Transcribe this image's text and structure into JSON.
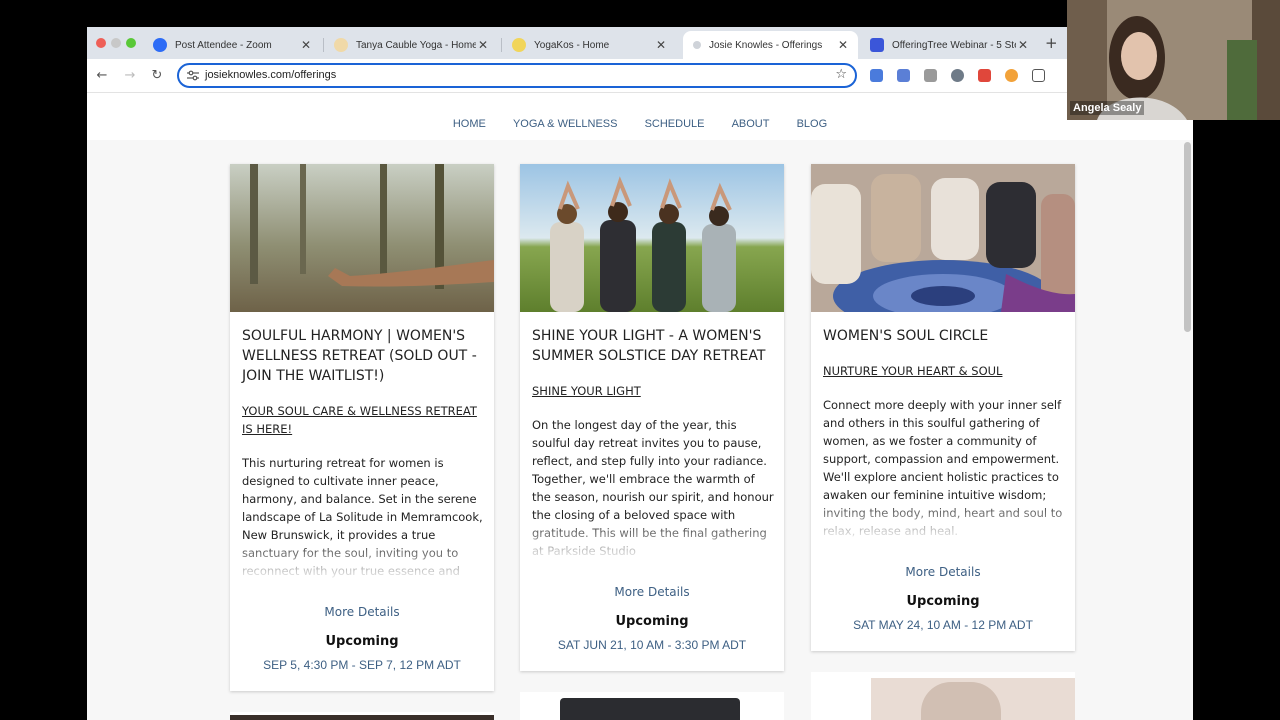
{
  "tabs": [
    {
      "title": "Post Attendee - Zoom",
      "favicon_color": "#2d6cf6",
      "active": false
    },
    {
      "title": "Tanya Cauble Yoga - Home",
      "favicon_color": "#f0d9a8",
      "active": false
    },
    {
      "title": "YogaKos - Home",
      "favicon_color": "#f1d55a",
      "active": false
    },
    {
      "title": "Josie Knowles - Offerings",
      "favicon_color": "#cfd3d9",
      "active": true
    },
    {
      "title": "OfferingTree Webinar - 5 Ste",
      "favicon_color": "#3b56d9",
      "active": false
    }
  ],
  "tab_close": "✕",
  "new_tab": "+",
  "toolbar": {
    "back": "←",
    "forward": "→",
    "reload": "↻",
    "url": "josieknowles.com/offerings",
    "star": "☆"
  },
  "nav": [
    "HOME",
    "YOGA & WELLNESS",
    "SCHEDULE",
    "ABOUT",
    "BLOG"
  ],
  "cards": [
    {
      "title": "SOULFUL HARMONY | WOMEN'S WELLNESS RETREAT (SOLD OUT - JOIN THE WAITLIST!)",
      "subtitle": "YOUR SOUL CARE & WELLNESS RETREAT IS HERE!",
      "description": "This nurturing retreat for women is designed to cultivate inner peace, harmony, and balance. Set in the serene landscape of La Solitude in Memramcook, New Brunswick, it provides a true sanctuary for the soul, inviting you to reconnect with your true essence and",
      "more": "More Details",
      "status": "Upcoming",
      "date": "SEP 5, 4:30 PM - SEP 7, 12 PM ADT"
    },
    {
      "title": "SHINE YOUR LIGHT - A WOMEN'S SUMMER SOLSTICE DAY RETREAT",
      "subtitle": "SHINE YOUR LIGHT",
      "description": "On the longest day of the year, this soulful day retreat invites you to pause, reflect, and step fully into your radiance. Together, we'll embrace the warmth of the season, nourish our spirit, and honour the closing of a beloved space with gratitude. This will be the final gathering at Parkside Studio",
      "more": "More Details",
      "status": "Upcoming",
      "date": "SAT JUN 21, 10 AM - 3:30 PM ADT"
    },
    {
      "title": "WOMEN'S SOUL CIRCLE",
      "subtitle": "NURTURE YOUR HEART & SOUL",
      "description": "Connect more deeply with your inner self and others in this soulful gathering of women, as we foster a community of support, compassion and empowerment. We'll explore ancient holistic practices to awaken our feminine intuitive wisdom; inviting the body, mind, heart and soul to relax, release and heal.",
      "more": "More Details",
      "status": "Upcoming",
      "date": "SAT MAY 24, 10 AM - 12 PM ADT"
    }
  ],
  "video": {
    "participant": "Angela Sealy"
  }
}
